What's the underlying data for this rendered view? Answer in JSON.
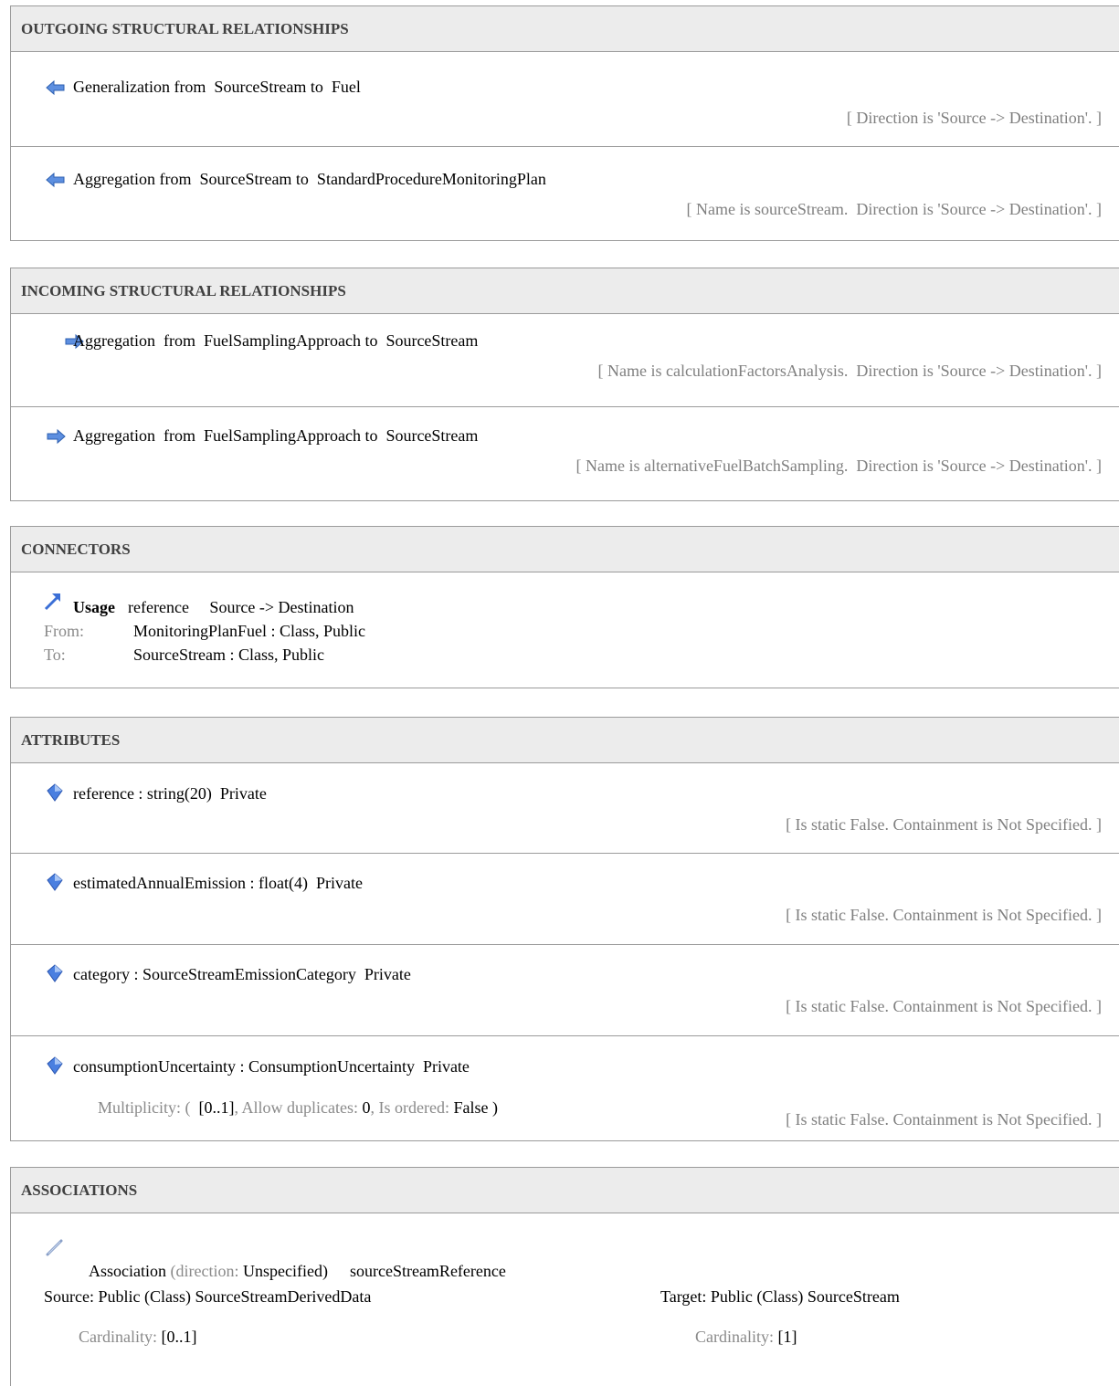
{
  "outgoing": {
    "header": "OUTGOING STRUCTURAL RELATIONSHIPS",
    "items": [
      {
        "text": "Generalization from  SourceStream to  Fuel",
        "detail": "[ Direction is 'Source -> Destination'. ]",
        "icon": "arrow-left-icon"
      },
      {
        "text": "Aggregation from  SourceStream to  StandardProcedureMonitoringPlan",
        "detail": "[ Name is sourceStream.  Direction is 'Source -> Destination'. ]",
        "icon": "arrow-left-icon"
      }
    ]
  },
  "incoming": {
    "header": "INCOMING STRUCTURAL RELATIONSHIPS",
    "items": [
      {
        "text": "Aggregation  from  FuelSamplingApproach to  SourceStream",
        "detail": "[ Name is calculationFactorsAnalysis.  Direction is 'Source -> Destination'. ]",
        "icon": "arrow-right-icon"
      },
      {
        "text": "Aggregation  from  FuelSamplingApproach to  SourceStream",
        "detail": "[ Name is alternativeFuelBatchSampling.  Direction is 'Source -> Destination'. ]",
        "icon": "arrow-right-icon"
      }
    ]
  },
  "connectors": {
    "header": "CONNECTORS",
    "usage_label": "Usage",
    "usage_text": "reference     Source -> Destination",
    "from_label": "From:",
    "from_value": "MonitoringPlanFuel : Class, Public",
    "to_label": "To:",
    "to_value": "SourceStream : Class, Public",
    "icon": "usage-arrow-icon"
  },
  "attributes": {
    "header": "ATTRIBUTES",
    "items": [
      {
        "text": "reference : string(20)  Private",
        "detail": "[ Is static False. Containment is Not Specified. ]"
      },
      {
        "text": "estimatedAnnualEmission : float(4)  Private",
        "detail": "[ Is static False. Containment is Not Specified. ]"
      },
      {
        "text": "category : SourceStreamEmissionCategory  Private",
        "detail": "[ Is static False. Containment is Not Specified. ]"
      },
      {
        "text": "consumptionUncertainty : ConsumptionUncertainty  Private",
        "detail": "[ Is static False. Containment is Not Specified. ]",
        "multiplicity": {
          "label": "Multiplicity: (  ",
          "value": "[0..1]",
          "dup_label": ", Allow duplicates: ",
          "dup_value": "0",
          "ord_label": ", Is ordered: ",
          "ord_value": "False",
          "close": " )"
        }
      }
    ],
    "icon": "attribute-icon"
  },
  "associations": {
    "header": "ASSOCIATIONS",
    "title_prefix": "Association ",
    "title_paren_open": "(",
    "direction_label": "direction: ",
    "direction_value": "Unspecified)",
    "role": "sourceStreamReference",
    "source": "Source: Public (Class) SourceStreamDerivedData",
    "source_card_label": "Cardinality: ",
    "source_card_value": "[0..1]",
    "target": "Target: Public (Class) SourceStream",
    "target_card_label": "Cardinality: ",
    "target_card_value": "[1]",
    "icon": "association-line-icon"
  },
  "colors": {
    "header_bg": "#ececec",
    "border": "#9b9b9b",
    "muted": "#808080",
    "icon_blue": "#3b6fd6"
  }
}
